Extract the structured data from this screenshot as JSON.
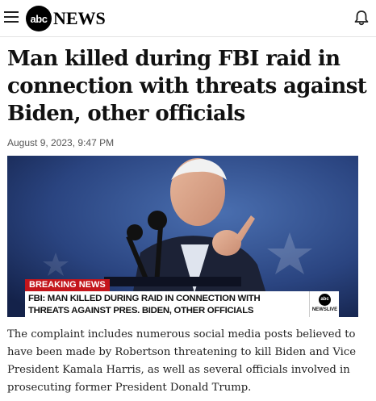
{
  "header": {
    "logo_circle": "abc",
    "logo_word": "NEWS"
  },
  "article": {
    "headline": "Man killed during FBI raid in connection with threats against Biden, other officials",
    "date": "August 9, 2023, 9:47 PM",
    "image": {
      "breaking_label": "BREAKING NEWS",
      "banner_line1": "FBI: MAN KILLED DURING RAID IN CONNECTION WITH",
      "banner_line2": "THREATS AGAINST PRES. BIDEN, OTHER OFFICIALS",
      "network_logo": "abc",
      "network_label": "NEWSLIVE"
    },
    "body": "The complaint includes numerous social media posts believed to have been made by Robertson threatening to kill Biden and Vice President Kamala Harris, as well as several officials involved in prosecuting former President Donald Trump."
  },
  "colors": {
    "breaking_red": "#c4161c",
    "photo_background_blue": "#1f3566"
  },
  "icons": [
    "menu-icon",
    "bell-icon"
  ]
}
